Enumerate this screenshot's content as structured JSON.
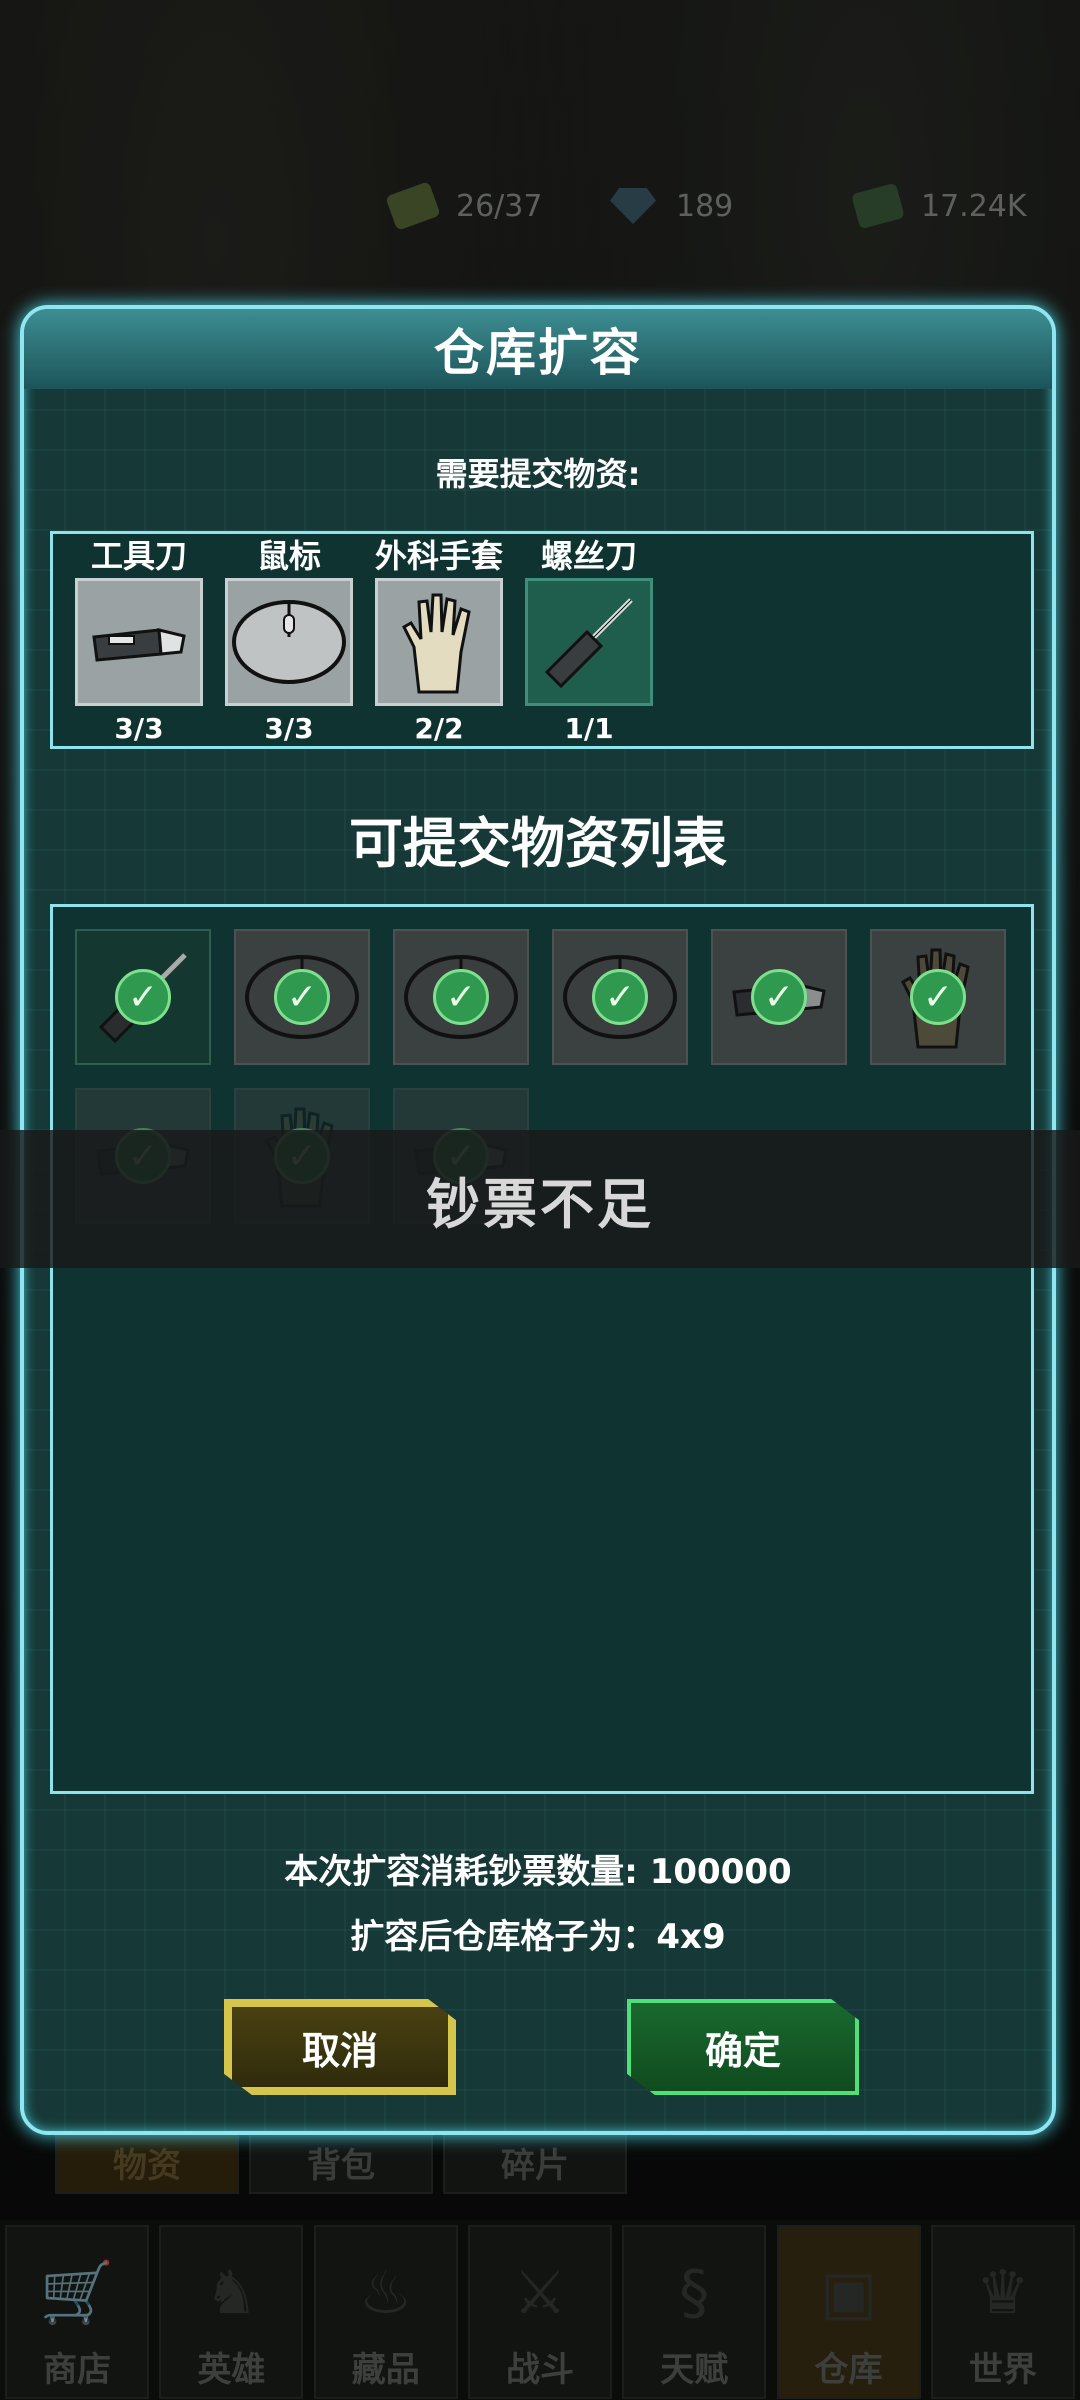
{
  "resources": [
    {
      "icon": "energy-icon",
      "value": "26/37"
    },
    {
      "icon": "diamond-icon",
      "value": "189"
    },
    {
      "icon": "cash-icon",
      "value": "17.24K"
    }
  ],
  "dialog": {
    "title": "仓库扩容",
    "need_label": "需要提交物资:",
    "required_items": [
      {
        "name": "工具刀",
        "count": "3/3",
        "icon": "utility-knife-icon"
      },
      {
        "name": "鼠标",
        "count": "3/3",
        "icon": "mouse-icon"
      },
      {
        "name": "外科手套",
        "count": "2/2",
        "icon": "surgical-glove-icon"
      },
      {
        "name": "螺丝刀",
        "count": "1/1",
        "icon": "screwdriver-icon"
      }
    ],
    "list_title": "可提交物资列表",
    "list_items": [
      {
        "icon": "screwdriver-icon",
        "checked": true
      },
      {
        "icon": "mouse-icon",
        "checked": true
      },
      {
        "icon": "mouse-icon",
        "checked": true
      },
      {
        "icon": "mouse-icon",
        "checked": true
      },
      {
        "icon": "utility-knife-icon",
        "checked": true
      },
      {
        "icon": "surgical-glove-icon",
        "checked": true
      },
      {
        "icon": "utility-knife-icon",
        "checked": true
      },
      {
        "icon": "surgical-glove-icon",
        "checked": true
      },
      {
        "icon": "utility-knife-icon",
        "checked": true
      }
    ],
    "cost_line": "本次扩容消耗钞票数量: 100000",
    "result_line": "扩容后仓库格子为：4x9",
    "cancel_label": "取消",
    "confirm_label": "确定"
  },
  "toast": "钞票不足",
  "subtabs": [
    "物资",
    "背包",
    "碎片"
  ],
  "nav": [
    "商店",
    "英雄",
    "藏品",
    "战斗",
    "天赋",
    "仓库",
    "世界"
  ],
  "colors": {
    "accent": "#8fe6f0",
    "panel": "#163836",
    "confirm": "#1a6a2f",
    "cancel_border": "#d5c54a",
    "check": "#2f9a4f"
  }
}
